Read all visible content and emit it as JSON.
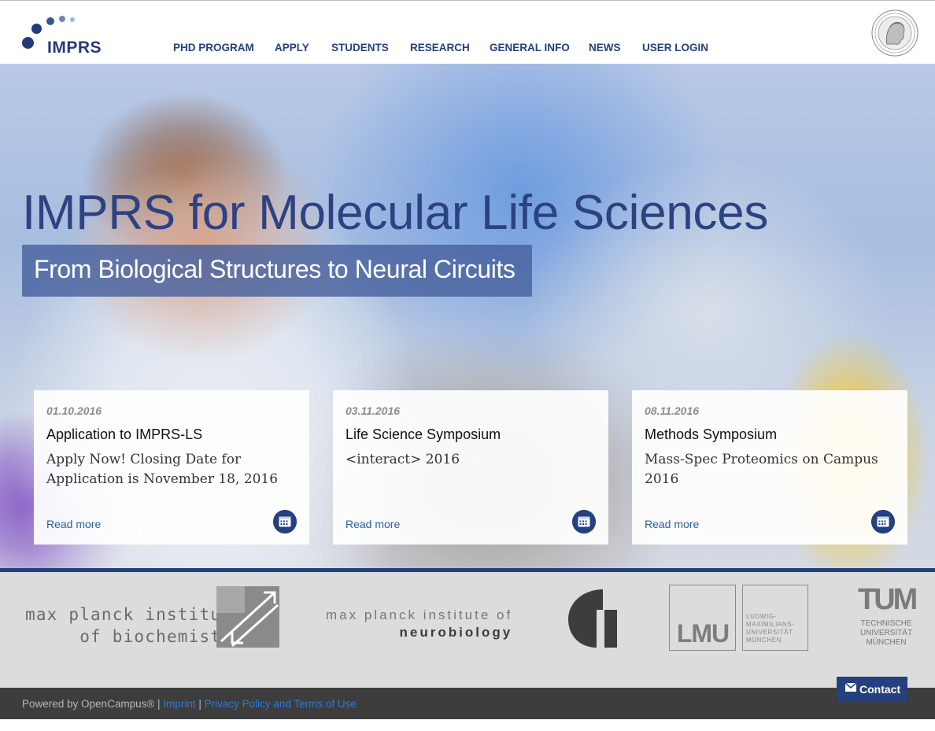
{
  "header": {
    "logo_text": "IMPRS",
    "nav": [
      {
        "label": "PHD PROGRAM"
      },
      {
        "label": "APPLY"
      },
      {
        "label": "STUDENTS"
      },
      {
        "label": "RESEARCH"
      },
      {
        "label": "GENERAL INFO"
      },
      {
        "label": "NEWS"
      },
      {
        "label": "USER LOGIN"
      }
    ],
    "seal_icon": "minerva-seal-icon"
  },
  "hero": {
    "title": "IMPRS for Molecular Life Sciences",
    "subtitle": "From Biological Structures to Neural Circuits"
  },
  "cards": [
    {
      "date": "01.10.2016",
      "title": "Application to IMPRS-LS",
      "desc": "Apply Now! Closing Date for Application is November 18, 2016",
      "link": "Read more"
    },
    {
      "date": "03.11.2016",
      "title": "Life Science Symposium",
      "desc": "<interact> 2016",
      "link": "Read more"
    },
    {
      "date": "08.11.2016",
      "title": "Methods Symposium",
      "desc": "Mass-Spec Proteomics on Campus 2016",
      "link": "Read more"
    }
  ],
  "partners": {
    "biochem_line1": "max planck institute",
    "biochem_line2": "of biochemistry",
    "neuro_line1": "max planck institute of",
    "neuro_line2": "neurobiology",
    "lmu_short": "LMU",
    "lmu_long": [
      "LUDWIG-",
      "MAXIMILIANS-",
      "UNIVERSITÄT",
      "MÜNCHEN"
    ],
    "tum_short": "TUM",
    "tum_long": [
      "TECHNISCHE",
      "UNIVERSITÄT",
      "MÜNCHEN"
    ]
  },
  "footer": {
    "powered": "Powered by OpenCampus® |",
    "imprint": "Imprint",
    "separator": "|",
    "privacy": "Privacy Policy and Terms of Use"
  },
  "contact": {
    "label": "Contact"
  },
  "colors": {
    "brand": "#24407e",
    "link": "#2a5fa3",
    "footer_bg": "#3d3d3d"
  }
}
